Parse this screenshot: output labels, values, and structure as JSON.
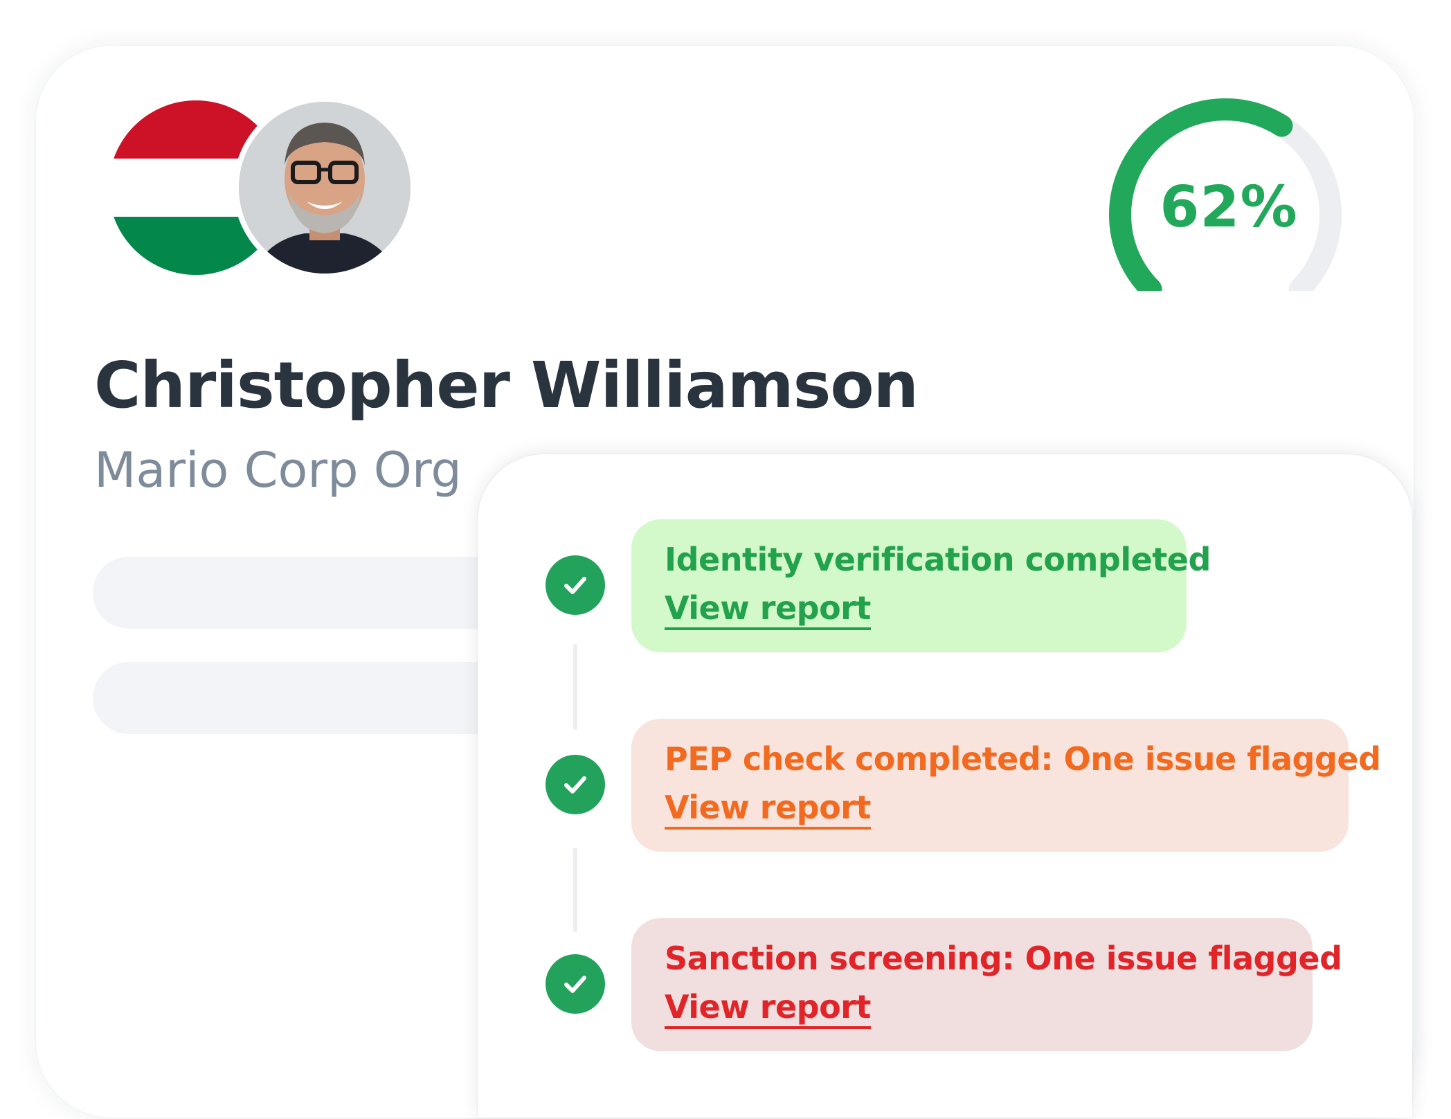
{
  "profile": {
    "name": "Christopher Williamson",
    "organization": "Mario Corp Org",
    "flag_colors": [
      "#cd1126",
      "#ffffff",
      "#03874a"
    ],
    "avatar_icon": "person-avatar-photo"
  },
  "score": {
    "value_text": "62%",
    "fraction": 0.62,
    "color": "#22a85a",
    "track_color": "#eceef2"
  },
  "checks": [
    {
      "title": "Identity verification completed",
      "link": "View report",
      "status_icon": "check-circle-icon",
      "text_color": "#22a24d",
      "bg_color": "#d3f8c9"
    },
    {
      "title": "PEP check completed: One issue flagged",
      "link": "View report",
      "status_icon": "check-circle-icon",
      "text_color": "#f26a1f",
      "bg_color": "#f8e3dd"
    },
    {
      "title": "Sanction screening: One issue flagged",
      "link": "View report",
      "status_icon": "check-circle-icon",
      "text_color": "#e02428",
      "bg_color": "#f1dedf"
    }
  ]
}
